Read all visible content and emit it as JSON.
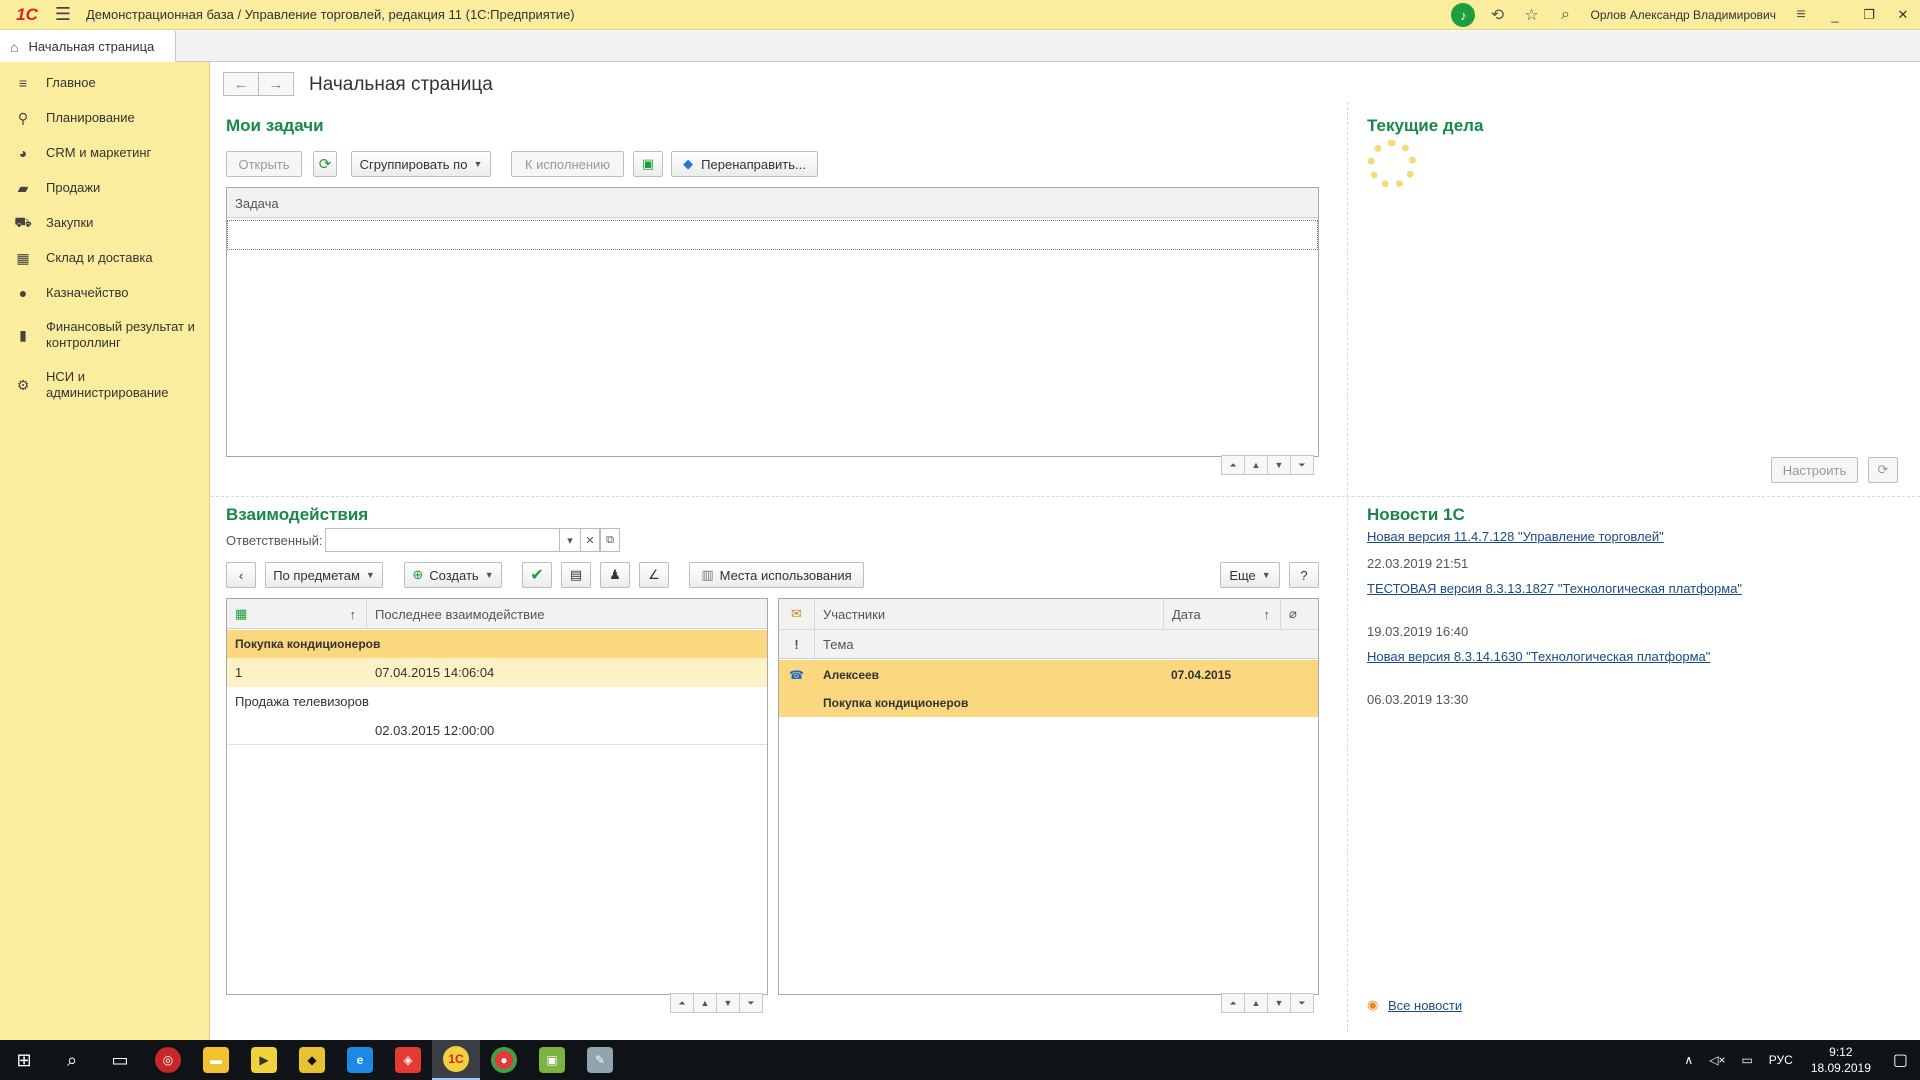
{
  "titlebar": {
    "logo": "1С",
    "title": "Демонстрационная база / Управление торговлей, редакция 11  (1С:Предприятие)",
    "user": "Орлов Александр Владимирович"
  },
  "tabs": [
    {
      "label": "Начальная страница"
    }
  ],
  "sidebar": {
    "items": [
      {
        "label": "Главное",
        "icon": "menu-lines-icon"
      },
      {
        "label": "Планирование",
        "icon": "planning-icon"
      },
      {
        "label": "CRM и маркетинг",
        "icon": "crm-icon"
      },
      {
        "label": "Продажи",
        "icon": "bag-icon"
      },
      {
        "label": "Закупки",
        "icon": "cart-icon"
      },
      {
        "label": "Склад и доставка",
        "icon": "warehouse-icon"
      },
      {
        "label": "Казначейство",
        "icon": "coin-icon"
      },
      {
        "label": "Финансовый результат и контроллинг",
        "icon": "bar-chart-icon"
      },
      {
        "label": "НСИ и администрирование",
        "icon": "gear-icon"
      }
    ]
  },
  "page": {
    "title": "Начальная страница"
  },
  "tasks": {
    "title": "Мои задачи",
    "buttons": {
      "open": "Открыть",
      "group_by": "Сгруппировать по",
      "to_execution": "К исполнению",
      "redirect": "Перенаправить..."
    },
    "column": "Задача"
  },
  "current_affairs": {
    "title": "Текущие дела",
    "configure": "Настроить"
  },
  "interactions": {
    "title": "Взаимодействия",
    "responsible_label": "Ответственный:",
    "responsible_value": "",
    "buttons": {
      "by_subjects": "По предметам",
      "create": "Создать",
      "usage_places": "Места использования",
      "more": "Еще",
      "help": "?"
    },
    "left_grid": {
      "columns": [
        "↑",
        "Последнее взаимодействие"
      ],
      "rows": [
        {
          "subject": "Покупка кондиционеров",
          "date": ""
        },
        {
          "subject": "1",
          "date": "07.04.2015 14:06:04"
        },
        {
          "subject": "Продажа телевизоров",
          "date": ""
        },
        {
          "subject": "",
          "date": "02.03.2015 12:00:00"
        }
      ]
    },
    "right_grid": {
      "columns": [
        "Участники",
        "Дата",
        "↑"
      ],
      "subcolumn": "Тема",
      "rows": [
        {
          "participants": "Алексеев",
          "date": "07.04.2015",
          "topic": "Покупка кондиционеров"
        }
      ]
    }
  },
  "news": {
    "title": "Новости 1С",
    "items": [
      {
        "link": "Новая версия 11.4.7.128 \"Управление торговлей\"",
        "date": "22.03.2019 21:51"
      },
      {
        "link": "ТЕСТОВАЯ версия 8.3.13.1827 \"Технологическая платформа\"",
        "date": "19.03.2019 16:40"
      },
      {
        "link": "Новая версия 8.3.14.1630 \"Технологическая платформа\"",
        "date": "06.03.2019 13:30"
      }
    ],
    "all_news": "Все новости"
  },
  "taskbar": {
    "lang": "РУС",
    "time": "9:12",
    "date": "18.09.2019"
  },
  "colors": {
    "accent_yellow": "#fbed9e",
    "section_green": "#18884a",
    "row_highlight": "#fbd87f",
    "link_blue": "#1a4a8a"
  }
}
